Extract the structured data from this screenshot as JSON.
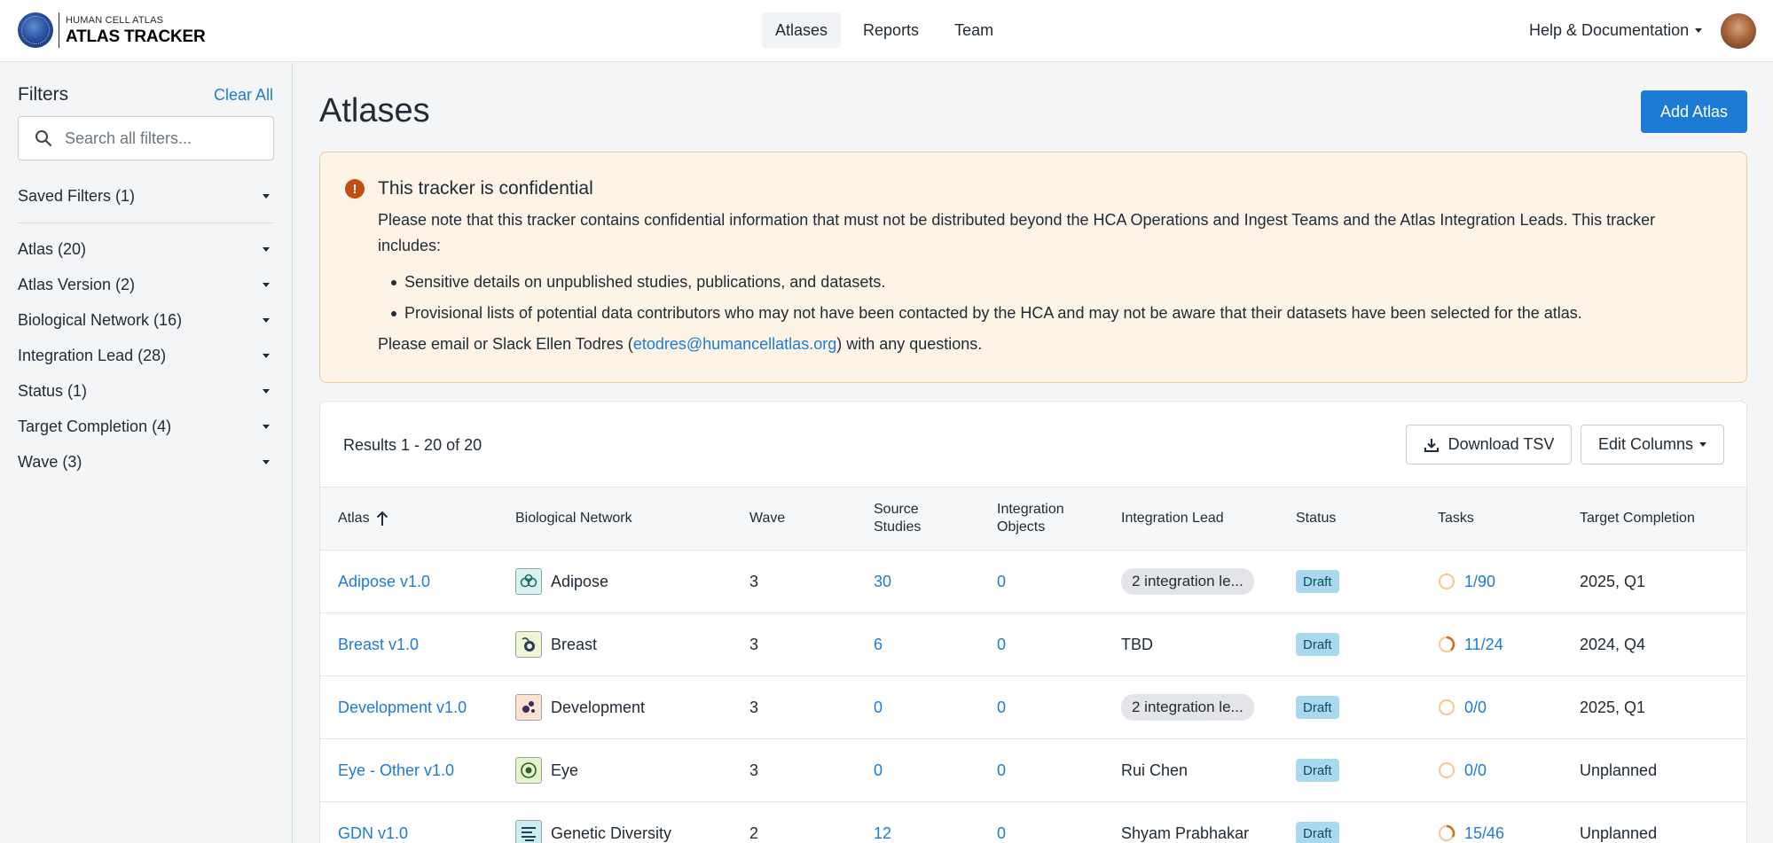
{
  "header": {
    "logo_small": "HUMAN CELL ATLAS",
    "logo_big": "ATLAS TRACKER",
    "nav": [
      {
        "label": "Atlases",
        "active": true
      },
      {
        "label": "Reports",
        "active": false
      },
      {
        "label": "Team",
        "active": false
      }
    ],
    "help_label": "Help & Documentation"
  },
  "sidebar": {
    "title": "Filters",
    "clear_all": "Clear All",
    "search_placeholder": "Search all filters...",
    "saved_filters": "Saved Filters (1)",
    "filters": [
      "Atlas (20)",
      "Atlas Version (2)",
      "Biological Network (16)",
      "Integration Lead (28)",
      "Status (1)",
      "Target Completion (4)",
      "Wave (3)"
    ]
  },
  "main": {
    "title": "Atlases",
    "add_button": "Add Atlas",
    "alert": {
      "title": "This tracker is confidential",
      "body": "Please note that this tracker contains confidential information that must not be distributed beyond the HCA Operations and Ingest Teams and the Atlas Integration Leads. This tracker includes:",
      "bullets": [
        "Sensitive details on unpublished studies, publications, and datasets.",
        "Provisional lists of potential data contributors who may not have been contacted by the HCA and may not be aware that their datasets have been selected for the atlas."
      ],
      "contact_prefix": "Please email or Slack Ellen Todres (",
      "contact_email": "etodres@humancellatlas.org",
      "contact_suffix": ") with any questions."
    },
    "results_label": "Results",
    "results_range": "1 - 20",
    "results_of": "of",
    "results_total": "20",
    "download_button": "Download TSV",
    "edit_columns_button": "Edit Columns",
    "columns": {
      "atlas": "Atlas",
      "network": "Biological Network",
      "wave": "Wave",
      "source_studies_1": "Source",
      "source_studies_2": "Studies",
      "integration_objects_1": "Integration",
      "integration_objects_2": "Objects",
      "lead": "Integration Lead",
      "status": "Status",
      "tasks": "Tasks",
      "target": "Target Completion"
    },
    "rows": [
      {
        "atlas": "Adipose v1.0",
        "network": "Adipose",
        "wave": "3",
        "source_studies": "30",
        "integration_objects": "0",
        "lead": "2 integration le...",
        "lead_chip": true,
        "status": "Draft",
        "tasks": "1/90",
        "target": "2025, Q1"
      },
      {
        "atlas": "Breast v1.0",
        "network": "Breast",
        "wave": "3",
        "source_studies": "6",
        "integration_objects": "0",
        "lead": "TBD",
        "lead_chip": false,
        "status": "Draft",
        "tasks": "11/24",
        "target": "2024, Q4"
      },
      {
        "atlas": "Development v1.0",
        "network": "Development",
        "wave": "3",
        "source_studies": "0",
        "integration_objects": "0",
        "lead": "2 integration le...",
        "lead_chip": true,
        "status": "Draft",
        "tasks": "0/0",
        "target": "2025, Q1"
      },
      {
        "atlas": "Eye - Other v1.0",
        "network": "Eye",
        "wave": "3",
        "source_studies": "0",
        "integration_objects": "0",
        "lead": "Rui Chen",
        "lead_chip": false,
        "status": "Draft",
        "tasks": "0/0",
        "target": "Unplanned"
      },
      {
        "atlas": "GDN v1.0",
        "network": "Genetic Diversity",
        "wave": "2",
        "source_studies": "12",
        "integration_objects": "0",
        "lead": "Shyam Prabhakar",
        "lead_chip": false,
        "status": "Draft",
        "tasks": "15/46",
        "target": "Unplanned"
      }
    ]
  },
  "colors": {
    "accent": "#1c7cd5",
    "alert_bg": "#fdf4e7",
    "alert_icon": "#c24f12",
    "draft_badge": "#a8d9ef",
    "task_ring": "#e8892a"
  }
}
